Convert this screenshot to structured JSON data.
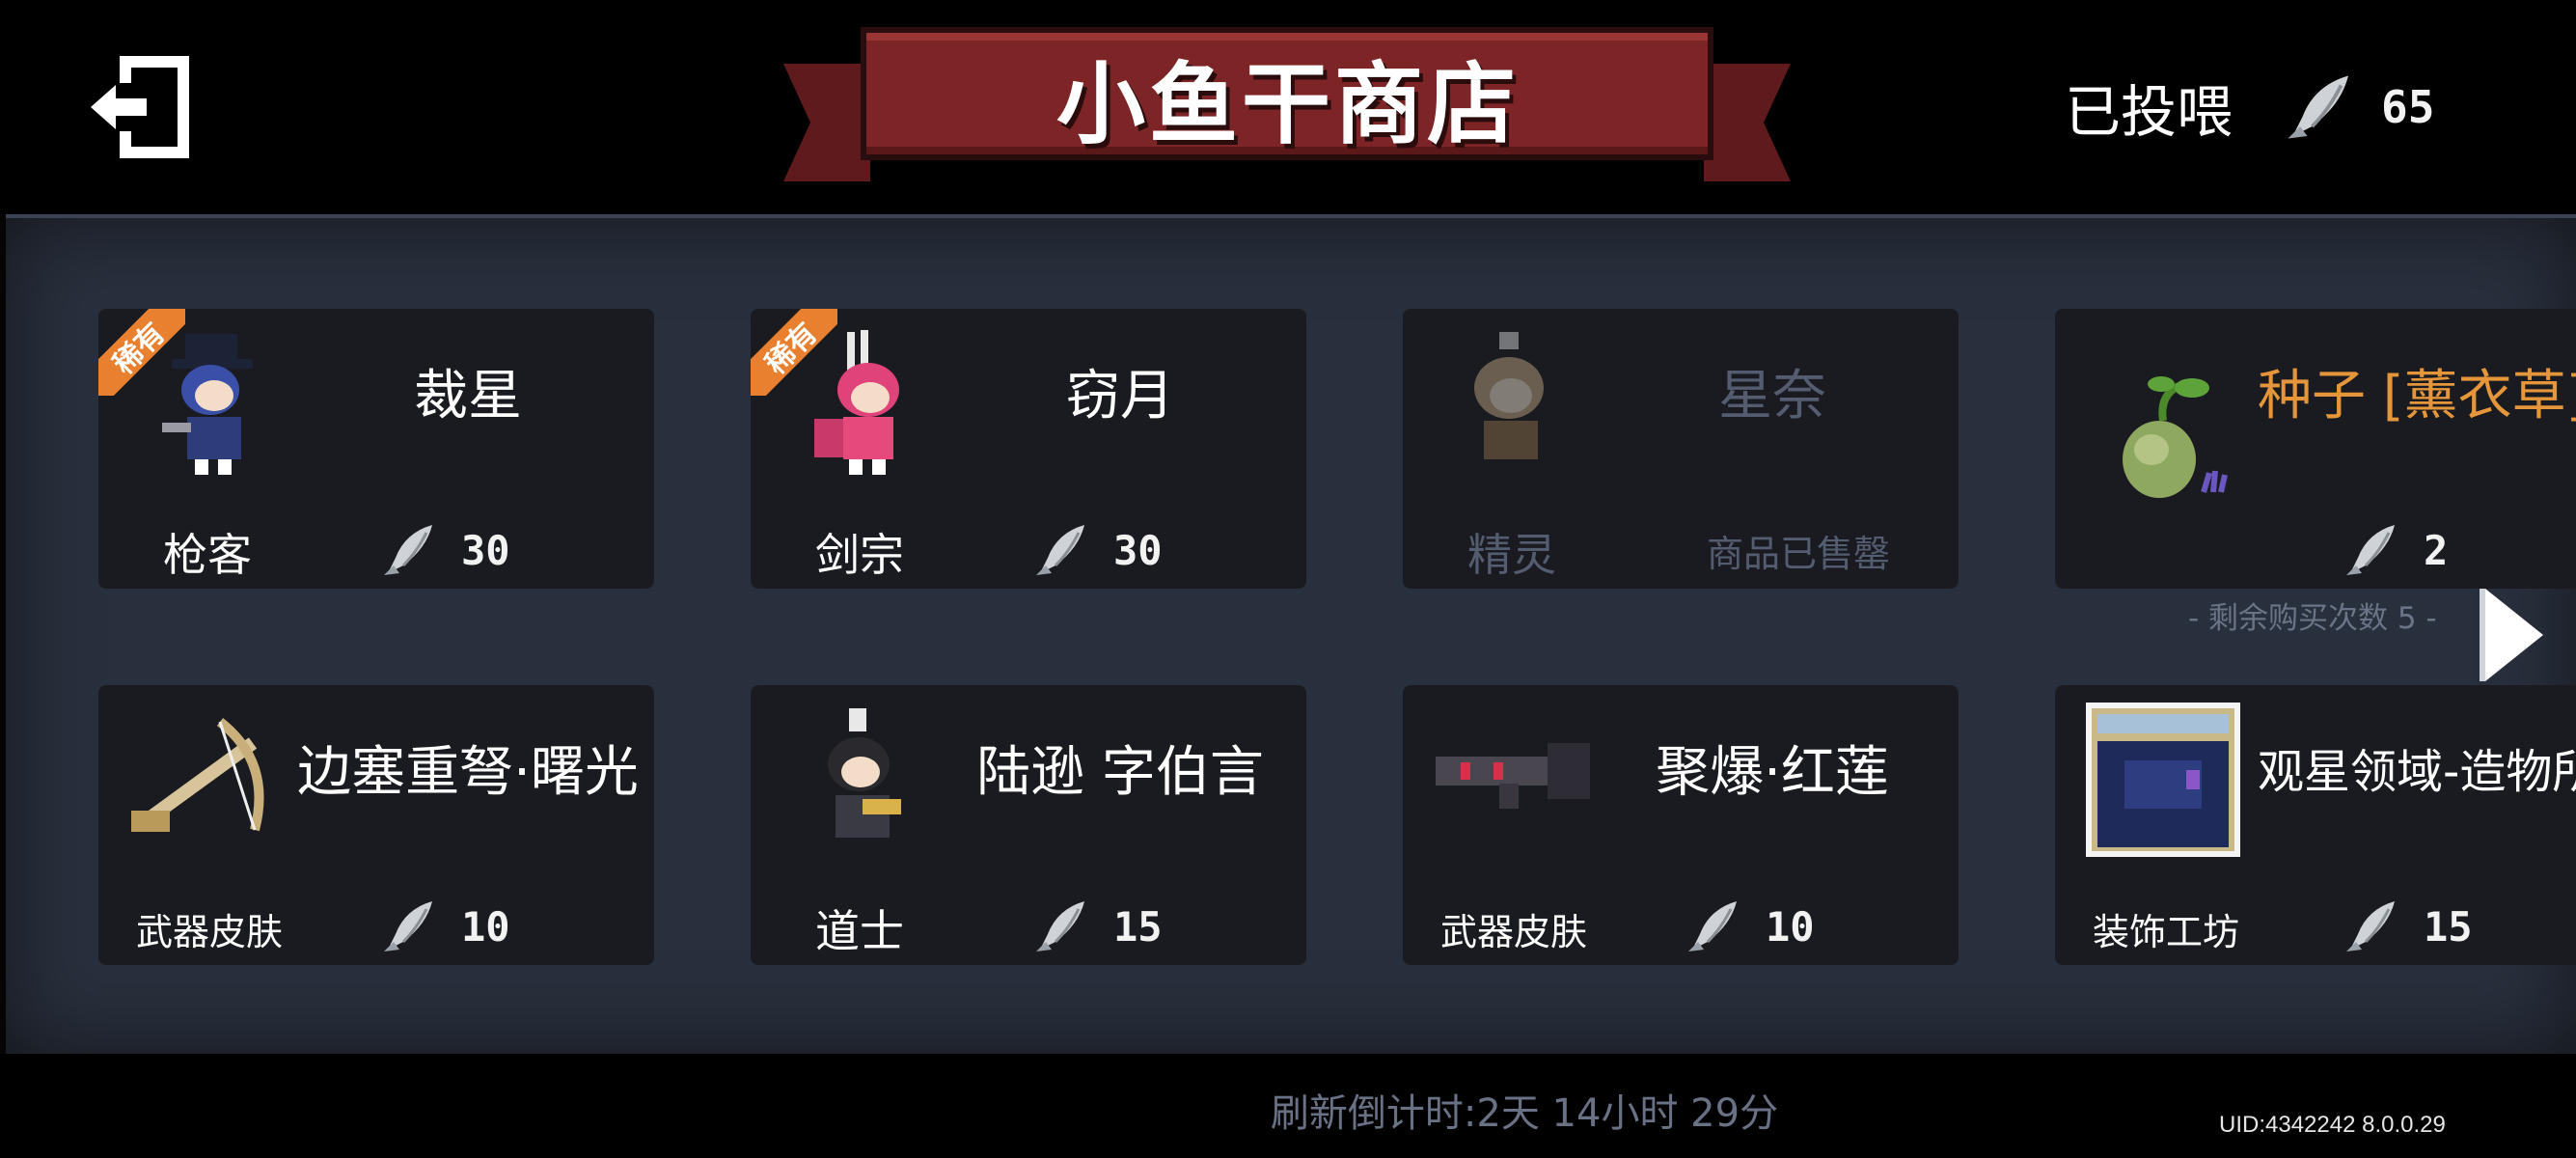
{
  "header": {
    "title": "小鱼干商店",
    "fed_label": "已投喂",
    "fed_count": "65",
    "exit_icon": "exit-icon",
    "currency_icon": "dried-fish-icon"
  },
  "cards": [
    {
      "name": "裁星",
      "category": "枪客",
      "price": "30",
      "badge": "稀有"
    },
    {
      "name": "窃月",
      "category": "剑宗",
      "price": "30",
      "badge": "稀有"
    },
    {
      "name": "星奈",
      "category": "精灵",
      "status": "商品已售罄"
    },
    {
      "name": "种子 [薰衣草]",
      "price": "2",
      "remaining": "- 剩余购买次数 5 -"
    },
    {
      "name": "边塞重弩·曙光",
      "category": "武器皮肤",
      "price": "10"
    },
    {
      "name": "陆逊 字伯言",
      "category": "道士",
      "price": "15"
    },
    {
      "name": "聚爆·红莲",
      "category": "武器皮肤",
      "price": "10"
    },
    {
      "name": "观星领域-造物所",
      "category": "装饰工坊",
      "price": "15"
    }
  ],
  "footer": {
    "refresh_countdown": "刷新倒计时:2天 14小时 29分",
    "uid": "UID:4342242 8.0.0.29"
  },
  "colors": {
    "banner_red": "#7d2526",
    "rare_orange": "#e8802f",
    "highlight_orange": "#e6963a",
    "panel": "#29303d",
    "card": "#191b20"
  }
}
